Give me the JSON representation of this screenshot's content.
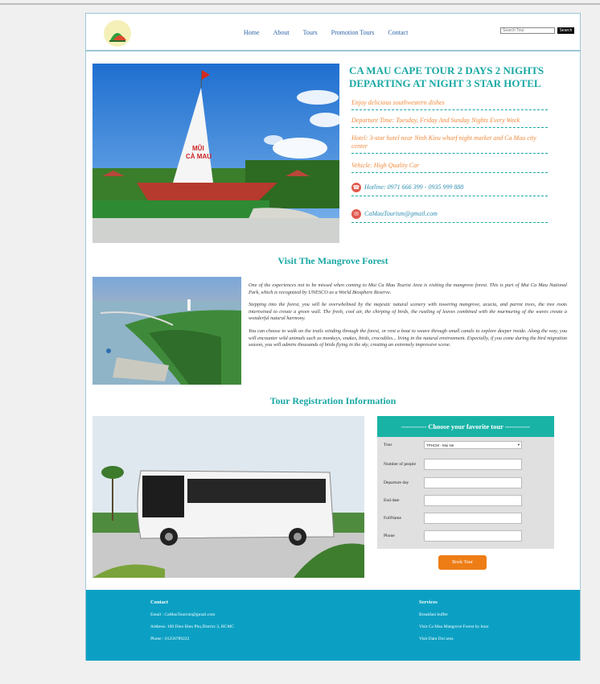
{
  "nav": {
    "items": [
      "Home",
      "About",
      "Tours",
      "Promotion Tours",
      "Contact"
    ]
  },
  "search": {
    "placeholder": "Search Tour",
    "button": "Search"
  },
  "hero": {
    "title": "CA MAU CAPE TOUR 2 DAYS 2 NIGHTS DEPARTING AT NIGHT 3 STAR HOTEL",
    "details": [
      "Enjoy delicious southwestern dishes",
      "Departure Time: Tuesday, Friday And Sunday Nights Every Week",
      "Hotel: 3-star hotel near Ninh Kieu wharf night market and Ca Mau city center",
      "Vehicle: High Quality Car"
    ],
    "hotline": "Hotline: 0971 666 399 - 0935 999 888",
    "email": "CaMauTourism@gmail.com",
    "monument_text": "MŨI\nCÀ MAU"
  },
  "mangrove": {
    "title": "Visit The Mangrove Forest",
    "paragraphs": [
      "One of the experiences not to be missed when coming to Mui Ca Mau Tourist Area is visiting the mangrove forest. This is part of Mui Ca Mau National Park, which is recognized by UNESCO as a World Biosphere Reserve.",
      "Stepping into the forest, you will be overwhelmed by the majestic natural scenery with towering mangrove, acacia, and parrot trees, the tree roots intertwined to create a green wall. The fresh, cool air, the chirping of birds, the rustling of leaves combined with the murmuring of the waves create a wonderful natural harmony.",
      "You can choose to walk on the trails winding through the forest, or rent a boat to weave through small canals to explore deeper inside. Along the way, you will encounter wild animals such as monkeys, snakes, birds, crocodiles... living in the natural environment. Especially, if you come during the bird migration season, you will admire thousands of birds flying in the sky, creating an extremely impressive scene."
    ]
  },
  "registration": {
    "title": "Tour Registration Information",
    "form_title": "----------- Choose your favorite tour -----------",
    "fields": {
      "tour_label": "Tour",
      "tour_value": "TPHCM - Mui Ne",
      "people_label": "Number of people",
      "departure_label": "Departure day",
      "end_label": "End date",
      "fullname_label": "FullName",
      "phone_label": "Phone"
    },
    "book_button": "Book Tour"
  },
  "footer": {
    "contact_title": "Contact",
    "email": "Email : CaMauTourism@gmail.com",
    "address": "Address: 100 Dien Bien Phu,District 3, HCMC",
    "phone": "Phone : 01256789222",
    "services_title": "Services",
    "services": [
      "Breakfast buffet",
      "Visit Ca Mau Mangrove Forest by boat",
      "Visit Dam Doi area"
    ]
  },
  "colors": {
    "accent": "#19a8a4",
    "orange": "#ef8a3c",
    "footer": "#0ba0c3",
    "nav_link": "#2b63a8"
  }
}
